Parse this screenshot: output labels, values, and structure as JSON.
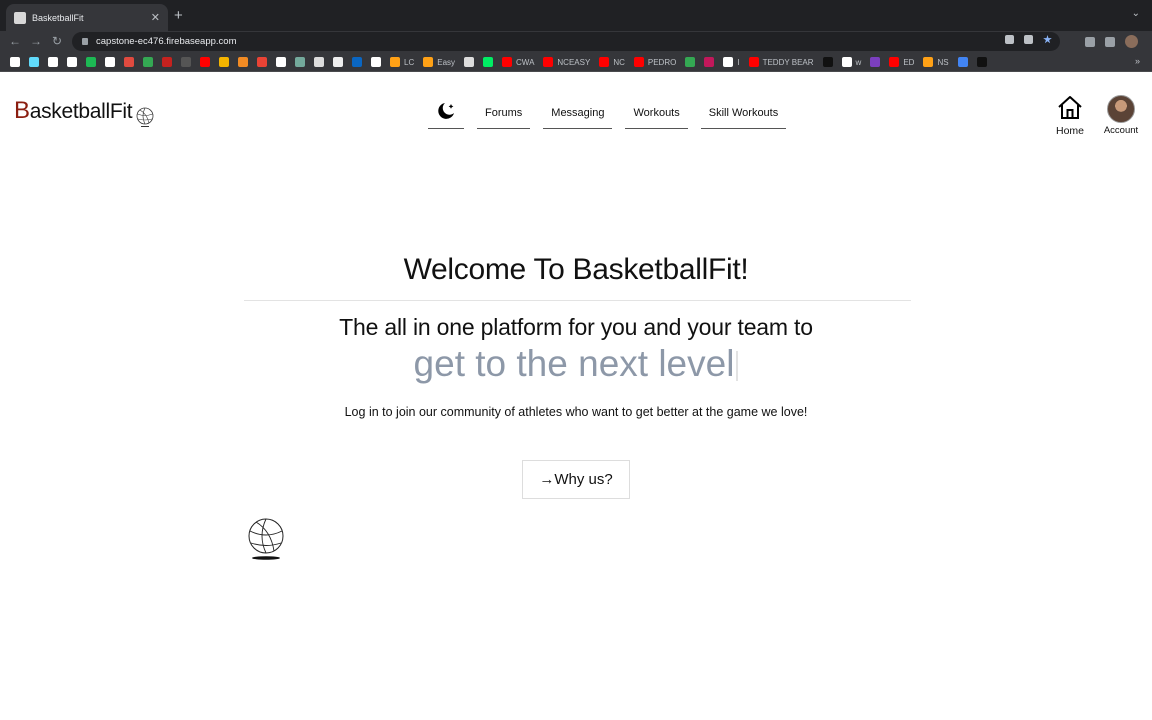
{
  "browser": {
    "tab_title": "BasketballFit",
    "url": "capstone-ec476.firebaseapp.com",
    "bookmarks": [
      {
        "icon": "n-icon",
        "color": "#ffffff",
        "label": ""
      },
      {
        "icon": "react-icon",
        "color": "#61dafb",
        "label": ""
      },
      {
        "icon": "github-icon",
        "color": "#ffffff",
        "label": ""
      },
      {
        "icon": "github-icon",
        "color": "#ffffff",
        "label": ""
      },
      {
        "icon": "spotify-icon",
        "color": "#1db954",
        "label": ""
      },
      {
        "icon": "google-icon",
        "color": "#ffffff",
        "label": ""
      },
      {
        "icon": "red-icon",
        "color": "#e04a3f",
        "label": ""
      },
      {
        "icon": "green-icon",
        "color": "#34a853",
        "label": ""
      },
      {
        "icon": "red-icon",
        "color": "#c5221f",
        "label": ""
      },
      {
        "icon": "dark-icon",
        "color": "#555555",
        "label": ""
      },
      {
        "icon": "youtube-icon",
        "color": "#ff0000",
        "label": ""
      },
      {
        "icon": "hand-icon",
        "color": "#f4b400",
        "label": ""
      },
      {
        "icon": "home-icon",
        "color": "#f28b24",
        "label": ""
      },
      {
        "icon": "gmail-icon",
        "color": "#ea4335",
        "label": ""
      },
      {
        "icon": "notion-icon",
        "color": "#ffffff",
        "label": ""
      },
      {
        "icon": "chatgpt-icon",
        "color": "#74aa9c",
        "label": ""
      },
      {
        "icon": "doc-icon",
        "color": "#dddddd",
        "label": ""
      },
      {
        "icon": "person-icon",
        "color": "#eeeeee",
        "label": ""
      },
      {
        "icon": "linkedin-icon",
        "color": "#0a66c2",
        "label": ""
      },
      {
        "icon": "triangle-icon",
        "color": "#ffffff",
        "label": ""
      },
      {
        "icon": "leetcode-icon",
        "color": "#ffa116",
        "label": "LC"
      },
      {
        "icon": "leetcode-icon",
        "color": "#ffa116",
        "label": "Easy"
      },
      {
        "icon": "y-icon",
        "color": "#dddddd",
        "label": ""
      },
      {
        "icon": "leaf-icon",
        "color": "#00ed64",
        "label": ""
      },
      {
        "icon": "youtube-icon",
        "color": "#ff0000",
        "label": "CWA"
      },
      {
        "icon": "youtube-icon",
        "color": "#ff0000",
        "label": "NCEASY"
      },
      {
        "icon": "youtube-icon",
        "color": "#ff0000",
        "label": "NC"
      },
      {
        "icon": "youtube-icon",
        "color": "#ff0000",
        "label": "PEDRO"
      },
      {
        "icon": "green-circle-icon",
        "color": "#34a853",
        "label": ""
      },
      {
        "icon": "pink-icon",
        "color": "#c2185b",
        "label": ""
      },
      {
        "icon": "google-icon",
        "color": "#ffffff",
        "label": "I"
      },
      {
        "icon": "youtube-icon",
        "color": "#ff0000",
        "label": "TEDDY BEAR"
      },
      {
        "icon": "dark-square-icon",
        "color": "#111111",
        "label": ""
      },
      {
        "icon": "google-icon",
        "color": "#ffffff",
        "label": "w"
      },
      {
        "icon": "firefox-icon",
        "color": "#7b3fbf",
        "label": ""
      },
      {
        "icon": "youtube-icon",
        "color": "#ff0000",
        "label": "ED"
      },
      {
        "icon": "leetcode-icon",
        "color": "#ffa116",
        "label": "NS"
      },
      {
        "icon": "docs-icon",
        "color": "#4285f4",
        "label": ""
      },
      {
        "icon": "hi-icon",
        "color": "#111111",
        "label": ""
      }
    ],
    "more": "»"
  },
  "header": {
    "logo_first": "B",
    "logo_rest": "asketballFit",
    "nav": [
      {
        "label": "Forums"
      },
      {
        "label": "Messaging"
      },
      {
        "label": "Workouts"
      },
      {
        "label": "Skill Workouts"
      }
    ],
    "home_label": "Home",
    "account_label": "Account"
  },
  "hero": {
    "title": "Welcome To BasketballFit!",
    "subtitle": "The all in one platform for you and your team to",
    "typed": "get to the next level",
    "description": "Log in to join our community of athletes who want to get better at the game we love!",
    "button_label": "→Why us?"
  },
  "colors": {
    "logo_accent": "#8b1e10",
    "typed_text": "#8d98a8"
  }
}
